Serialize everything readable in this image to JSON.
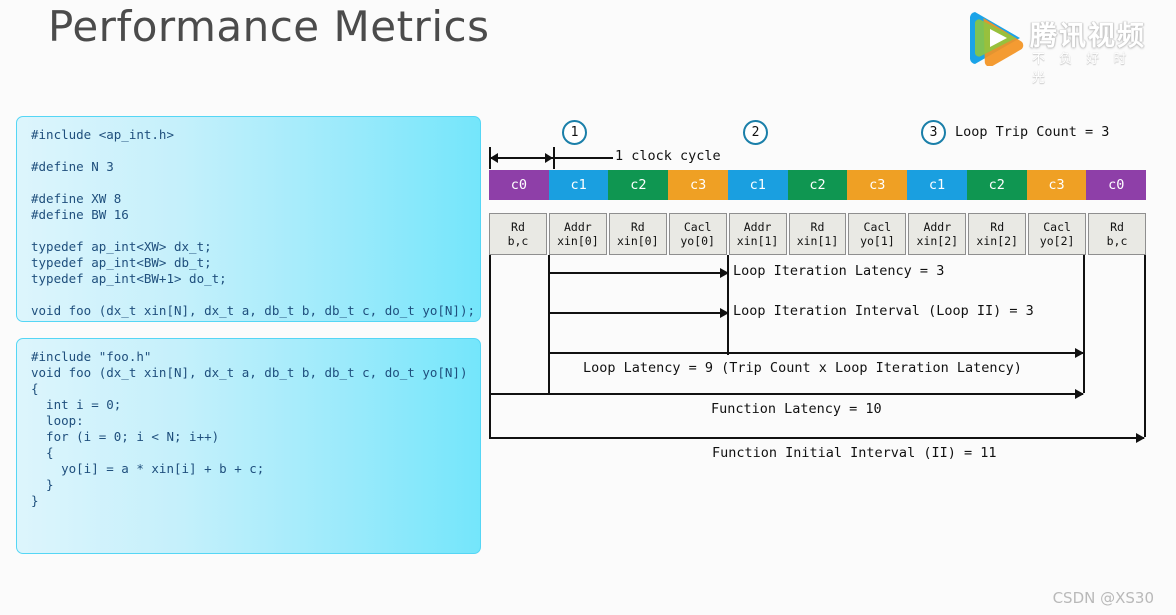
{
  "page_title": "Performance Metrics",
  "brand": {
    "logo_icon": "tencent-video-play-icon",
    "name_cn": "腾讯视频",
    "tagline_cn": "不 负 好 时 光"
  },
  "code_panels": [
    {
      "id": "header",
      "code": "#include <ap_int.h>\n\n#define N 3\n\n#define XW 8\n#define BW 16\n\ntypedef ap_int<XW> dx_t;\ntypedef ap_int<BW> db_t;\ntypedef ap_int<BW+1> do_t;\n\nvoid foo (dx_t xin[N], dx_t a, db_t b, db_t c, do_t yo[N]);"
    },
    {
      "id": "source",
      "code": "#include \"foo.h\"\nvoid foo (dx_t xin[N], dx_t a, db_t b, db_t c, do_t yo[N])\n{\n  int i = 0;\n  loop:\n  for (i = 0; i < N; i++)\n  {\n    yo[i] = a * xin[i] + b + c;\n  }\n}"
    }
  ],
  "diagram": {
    "badges": [
      {
        "number": "1",
        "note": ""
      },
      {
        "number": "2",
        "note": ""
      },
      {
        "number": "3",
        "note": "Loop Trip Count = 3"
      }
    ],
    "clock_cycle_label": "1 clock cycle",
    "cycles": [
      {
        "label": "c0",
        "color": "#8e3fa8"
      },
      {
        "label": "c1",
        "color": "#1a9fe0"
      },
      {
        "label": "c2",
        "color": "#0f9651"
      },
      {
        "label": "c3",
        "color": "#efa024"
      },
      {
        "label": "c1",
        "color": "#1a9fe0"
      },
      {
        "label": "c2",
        "color": "#0f9651"
      },
      {
        "label": "c3",
        "color": "#efa024"
      },
      {
        "label": "c1",
        "color": "#1a9fe0"
      },
      {
        "label": "c2",
        "color": "#0f9651"
      },
      {
        "label": "c3",
        "color": "#efa024"
      },
      {
        "label": "c0",
        "color": "#8e3fa8"
      }
    ],
    "operations": [
      {
        "line1": "Rd",
        "line2": "b,c"
      },
      {
        "line1": "Addr",
        "line2": "xin[0]"
      },
      {
        "line1": "Rd",
        "line2": "xin[0]"
      },
      {
        "line1": "Cacl",
        "line2": "yo[0]"
      },
      {
        "line1": "Addr",
        "line2": "xin[1]"
      },
      {
        "line1": "Rd",
        "line2": "xin[1]"
      },
      {
        "line1": "Cacl",
        "line2": "yo[1]"
      },
      {
        "line1": "Addr",
        "line2": "xin[2]"
      },
      {
        "line1": "Rd",
        "line2": "xin[2]"
      },
      {
        "line1": "Cacl",
        "line2": "yo[2]"
      },
      {
        "line1": "Rd",
        "line2": "b,c"
      }
    ],
    "annotations": {
      "loop_iteration_latency": "Loop Iteration Latency = 3",
      "loop_iteration_interval": "Loop Iteration Interval (Loop II) = 3",
      "loop_latency": "Loop Latency = 9 (Trip Count x Loop Iteration Latency)",
      "function_latency": "Function Latency = 10",
      "function_initial_interval": "Function Initial Interval (II) = 11"
    }
  },
  "watermark": "CSDN @XS30",
  "colors": {
    "accent_circle": "#1a7fa9",
    "code_border": "#55d6f5",
    "title_text": "#4b4b4b"
  }
}
